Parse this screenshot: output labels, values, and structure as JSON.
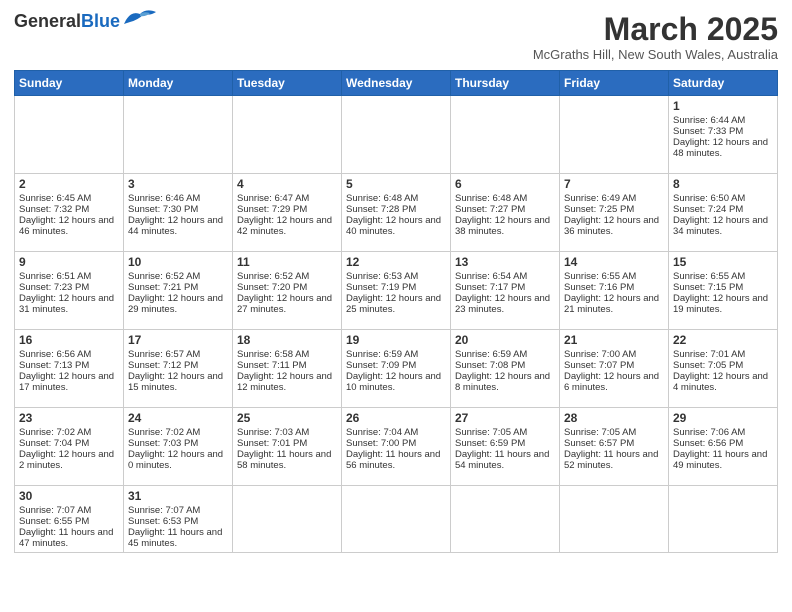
{
  "logo": {
    "text_general": "General",
    "text_blue": "Blue"
  },
  "title": "March 2025",
  "subtitle": "McGraths Hill, New South Wales, Australia",
  "weekdays": [
    "Sunday",
    "Monday",
    "Tuesday",
    "Wednesday",
    "Thursday",
    "Friday",
    "Saturday"
  ],
  "weeks": [
    [
      {
        "day": "",
        "sunrise": "",
        "sunset": "",
        "daylight": ""
      },
      {
        "day": "",
        "sunrise": "",
        "sunset": "",
        "daylight": ""
      },
      {
        "day": "",
        "sunrise": "",
        "sunset": "",
        "daylight": ""
      },
      {
        "day": "",
        "sunrise": "",
        "sunset": "",
        "daylight": ""
      },
      {
        "day": "",
        "sunrise": "",
        "sunset": "",
        "daylight": ""
      },
      {
        "day": "",
        "sunrise": "",
        "sunset": "",
        "daylight": ""
      },
      {
        "day": "1",
        "sunrise": "Sunrise: 6:44 AM",
        "sunset": "Sunset: 7:33 PM",
        "daylight": "Daylight: 12 hours and 48 minutes."
      }
    ],
    [
      {
        "day": "2",
        "sunrise": "Sunrise: 6:45 AM",
        "sunset": "Sunset: 7:32 PM",
        "daylight": "Daylight: 12 hours and 46 minutes."
      },
      {
        "day": "3",
        "sunrise": "Sunrise: 6:46 AM",
        "sunset": "Sunset: 7:30 PM",
        "daylight": "Daylight: 12 hours and 44 minutes."
      },
      {
        "day": "4",
        "sunrise": "Sunrise: 6:47 AM",
        "sunset": "Sunset: 7:29 PM",
        "daylight": "Daylight: 12 hours and 42 minutes."
      },
      {
        "day": "5",
        "sunrise": "Sunrise: 6:48 AM",
        "sunset": "Sunset: 7:28 PM",
        "daylight": "Daylight: 12 hours and 40 minutes."
      },
      {
        "day": "6",
        "sunrise": "Sunrise: 6:48 AM",
        "sunset": "Sunset: 7:27 PM",
        "daylight": "Daylight: 12 hours and 38 minutes."
      },
      {
        "day": "7",
        "sunrise": "Sunrise: 6:49 AM",
        "sunset": "Sunset: 7:25 PM",
        "daylight": "Daylight: 12 hours and 36 minutes."
      },
      {
        "day": "8",
        "sunrise": "Sunrise: 6:50 AM",
        "sunset": "Sunset: 7:24 PM",
        "daylight": "Daylight: 12 hours and 34 minutes."
      }
    ],
    [
      {
        "day": "9",
        "sunrise": "Sunrise: 6:51 AM",
        "sunset": "Sunset: 7:23 PM",
        "daylight": "Daylight: 12 hours and 31 minutes."
      },
      {
        "day": "10",
        "sunrise": "Sunrise: 6:52 AM",
        "sunset": "Sunset: 7:21 PM",
        "daylight": "Daylight: 12 hours and 29 minutes."
      },
      {
        "day": "11",
        "sunrise": "Sunrise: 6:52 AM",
        "sunset": "Sunset: 7:20 PM",
        "daylight": "Daylight: 12 hours and 27 minutes."
      },
      {
        "day": "12",
        "sunrise": "Sunrise: 6:53 AM",
        "sunset": "Sunset: 7:19 PM",
        "daylight": "Daylight: 12 hours and 25 minutes."
      },
      {
        "day": "13",
        "sunrise": "Sunrise: 6:54 AM",
        "sunset": "Sunset: 7:17 PM",
        "daylight": "Daylight: 12 hours and 23 minutes."
      },
      {
        "day": "14",
        "sunrise": "Sunrise: 6:55 AM",
        "sunset": "Sunset: 7:16 PM",
        "daylight": "Daylight: 12 hours and 21 minutes."
      },
      {
        "day": "15",
        "sunrise": "Sunrise: 6:55 AM",
        "sunset": "Sunset: 7:15 PM",
        "daylight": "Daylight: 12 hours and 19 minutes."
      }
    ],
    [
      {
        "day": "16",
        "sunrise": "Sunrise: 6:56 AM",
        "sunset": "Sunset: 7:13 PM",
        "daylight": "Daylight: 12 hours and 17 minutes."
      },
      {
        "day": "17",
        "sunrise": "Sunrise: 6:57 AM",
        "sunset": "Sunset: 7:12 PM",
        "daylight": "Daylight: 12 hours and 15 minutes."
      },
      {
        "day": "18",
        "sunrise": "Sunrise: 6:58 AM",
        "sunset": "Sunset: 7:11 PM",
        "daylight": "Daylight: 12 hours and 12 minutes."
      },
      {
        "day": "19",
        "sunrise": "Sunrise: 6:59 AM",
        "sunset": "Sunset: 7:09 PM",
        "daylight": "Daylight: 12 hours and 10 minutes."
      },
      {
        "day": "20",
        "sunrise": "Sunrise: 6:59 AM",
        "sunset": "Sunset: 7:08 PM",
        "daylight": "Daylight: 12 hours and 8 minutes."
      },
      {
        "day": "21",
        "sunrise": "Sunrise: 7:00 AM",
        "sunset": "Sunset: 7:07 PM",
        "daylight": "Daylight: 12 hours and 6 minutes."
      },
      {
        "day": "22",
        "sunrise": "Sunrise: 7:01 AM",
        "sunset": "Sunset: 7:05 PM",
        "daylight": "Daylight: 12 hours and 4 minutes."
      }
    ],
    [
      {
        "day": "23",
        "sunrise": "Sunrise: 7:02 AM",
        "sunset": "Sunset: 7:04 PM",
        "daylight": "Daylight: 12 hours and 2 minutes."
      },
      {
        "day": "24",
        "sunrise": "Sunrise: 7:02 AM",
        "sunset": "Sunset: 7:03 PM",
        "daylight": "Daylight: 12 hours and 0 minutes."
      },
      {
        "day": "25",
        "sunrise": "Sunrise: 7:03 AM",
        "sunset": "Sunset: 7:01 PM",
        "daylight": "Daylight: 11 hours and 58 minutes."
      },
      {
        "day": "26",
        "sunrise": "Sunrise: 7:04 AM",
        "sunset": "Sunset: 7:00 PM",
        "daylight": "Daylight: 11 hours and 56 minutes."
      },
      {
        "day": "27",
        "sunrise": "Sunrise: 7:05 AM",
        "sunset": "Sunset: 6:59 PM",
        "daylight": "Daylight: 11 hours and 54 minutes."
      },
      {
        "day": "28",
        "sunrise": "Sunrise: 7:05 AM",
        "sunset": "Sunset: 6:57 PM",
        "daylight": "Daylight: 11 hours and 52 minutes."
      },
      {
        "day": "29",
        "sunrise": "Sunrise: 7:06 AM",
        "sunset": "Sunset: 6:56 PM",
        "daylight": "Daylight: 11 hours and 49 minutes."
      }
    ],
    [
      {
        "day": "30",
        "sunrise": "Sunrise: 7:07 AM",
        "sunset": "Sunset: 6:55 PM",
        "daylight": "Daylight: 11 hours and 47 minutes."
      },
      {
        "day": "31",
        "sunrise": "Sunrise: 7:07 AM",
        "sunset": "Sunset: 6:53 PM",
        "daylight": "Daylight: 11 hours and 45 minutes."
      },
      {
        "day": "",
        "sunrise": "",
        "sunset": "",
        "daylight": ""
      },
      {
        "day": "",
        "sunrise": "",
        "sunset": "",
        "daylight": ""
      },
      {
        "day": "",
        "sunrise": "",
        "sunset": "",
        "daylight": ""
      },
      {
        "day": "",
        "sunrise": "",
        "sunset": "",
        "daylight": ""
      },
      {
        "day": "",
        "sunrise": "",
        "sunset": "",
        "daylight": ""
      }
    ]
  ]
}
